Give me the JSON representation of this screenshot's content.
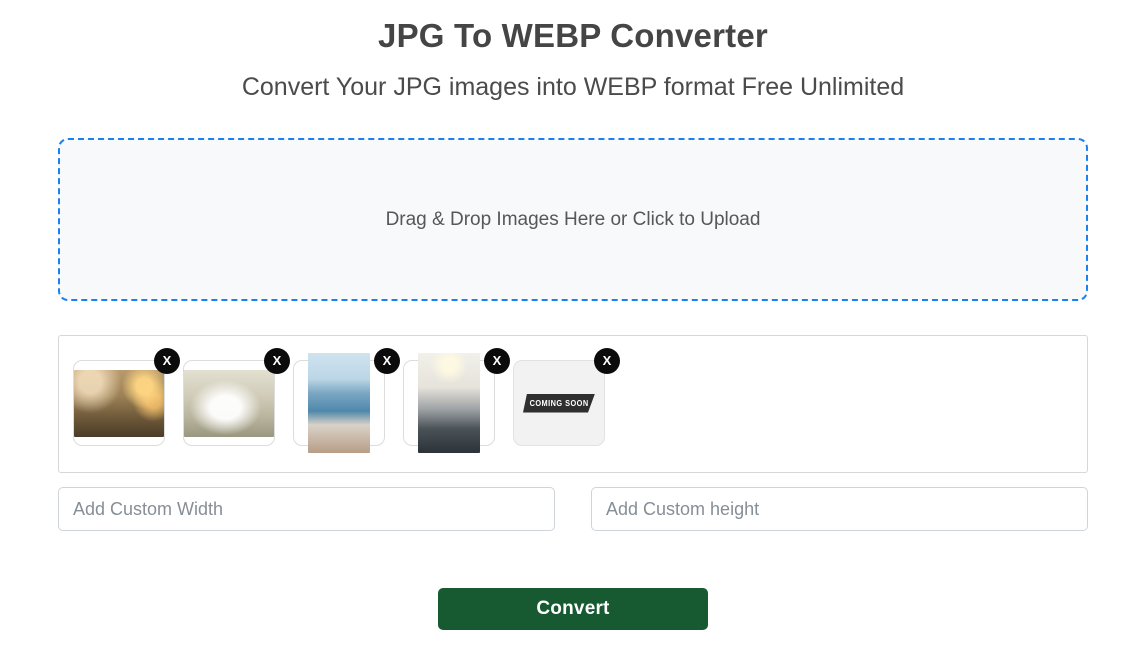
{
  "header": {
    "title": "JPG To WEBP Converter",
    "subtitle": "Convert Your JPG images into WEBP format Free Unlimited"
  },
  "dropzone": {
    "text": "Drag & Drop Images Here or Click to Upload",
    "border_color": "#1a82f0",
    "background_color": "#f7f9fa"
  },
  "thumbnails": {
    "remove_label": "X",
    "items": [
      {
        "alt": "Outdoor wedding cake cutting with string lights",
        "orientation": "landscape",
        "kind": "photo"
      },
      {
        "alt": "Bride with long veil outdoors among trees",
        "orientation": "landscape",
        "kind": "photo"
      },
      {
        "alt": "Couple on a boat by a lake with mountains",
        "orientation": "portrait",
        "kind": "photo"
      },
      {
        "alt": "Indoor ceremony hall with chandelier and dark aisle",
        "orientation": "portrait",
        "kind": "photo"
      },
      {
        "alt": "Coming soon placeholder",
        "orientation": "landscape",
        "kind": "placeholder",
        "ribbon_text": "COMING SOON"
      }
    ]
  },
  "options": {
    "width_placeholder": "Add Custom Width",
    "width_value": "",
    "height_placeholder": "Add Custom height",
    "height_value": ""
  },
  "actions": {
    "convert_label": "Convert",
    "convert_color": "#175a31"
  }
}
